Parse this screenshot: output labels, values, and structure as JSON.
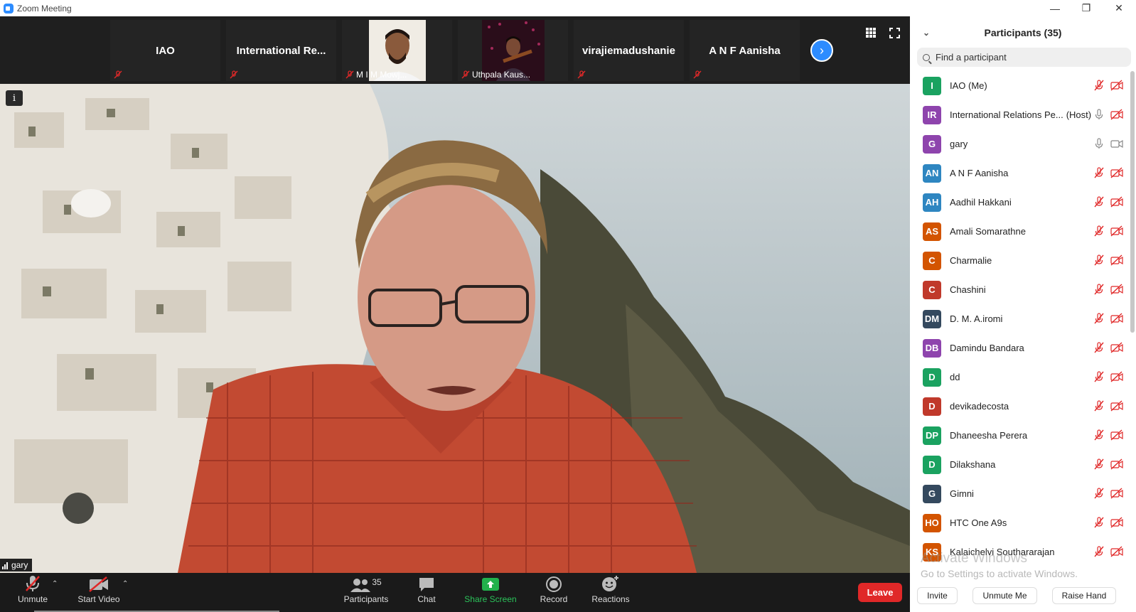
{
  "window": {
    "title": "Zoom Meeting"
  },
  "colors": {
    "accent": "#2d8cff",
    "leave": "#e02828",
    "mute": "#e02828",
    "share": "#22b14c"
  },
  "strip": {
    "thumbs": [
      {
        "name": "IAO",
        "caption": ""
      },
      {
        "name": "International  Re...",
        "caption": ""
      },
      {
        "name": "",
        "caption": "M I M Mowj..."
      },
      {
        "name": "",
        "caption": "Uthpala Kaus..."
      },
      {
        "name": "virajiemadushanie",
        "caption": ""
      },
      {
        "name": "A N F Aanisha",
        "caption": ""
      }
    ]
  },
  "stage": {
    "speaker_label": "gary"
  },
  "toolbar": {
    "unmute": "Unmute",
    "start_video": "Start Video",
    "participants": "Participants",
    "participants_count": "35",
    "chat": "Chat",
    "share_screen": "Share Screen",
    "record": "Record",
    "reactions": "Reactions",
    "leave": "Leave"
  },
  "panel": {
    "title": "Participants (35)",
    "search_placeholder": "Find a participant",
    "participants": [
      {
        "initials": "I",
        "name": "IAO (Me)",
        "host": "",
        "color": "#1aa260",
        "mic": "muted",
        "video": "off"
      },
      {
        "initials": "IR",
        "name": "International Relations Pe...",
        "host": "(Host)",
        "color": "#8e44ad",
        "mic": "on",
        "video": "off"
      },
      {
        "initials": "G",
        "name": "gary",
        "host": "",
        "color": "#8e44ad",
        "mic": "on",
        "video": "on"
      },
      {
        "initials": "AN",
        "name": "A N F Aanisha",
        "host": "",
        "color": "#2e86c1",
        "mic": "muted",
        "video": "off"
      },
      {
        "initials": "AH",
        "name": "Aadhil Hakkani",
        "host": "",
        "color": "#2e86c1",
        "mic": "muted",
        "video": "off"
      },
      {
        "initials": "AS",
        "name": "Amali Somarathne",
        "host": "",
        "color": "#d35400",
        "mic": "muted",
        "video": "off"
      },
      {
        "initials": "C",
        "name": "Charmalie",
        "host": "",
        "color": "#d35400",
        "mic": "muted",
        "video": "off"
      },
      {
        "initials": "C",
        "name": "Chashini",
        "host": "",
        "color": "#c0392b",
        "mic": "muted",
        "video": "off"
      },
      {
        "initials": "DM",
        "name": "D. M. A.iromi",
        "host": "",
        "color": "#34495e",
        "mic": "muted",
        "video": "off"
      },
      {
        "initials": "DB",
        "name": "Damindu Bandara",
        "host": "",
        "color": "#8e44ad",
        "mic": "muted",
        "video": "off"
      },
      {
        "initials": "D",
        "name": "dd",
        "host": "",
        "color": "#1aa260",
        "mic": "muted",
        "video": "off"
      },
      {
        "initials": "D",
        "name": "devikadecosta",
        "host": "",
        "color": "#c0392b",
        "mic": "muted",
        "video": "off"
      },
      {
        "initials": "DP",
        "name": "Dhaneesha Perera",
        "host": "",
        "color": "#1aa260",
        "mic": "muted",
        "video": "off"
      },
      {
        "initials": "D",
        "name": "Dilakshana",
        "host": "",
        "color": "#1aa260",
        "mic": "muted",
        "video": "off"
      },
      {
        "initials": "G",
        "name": "Gimni",
        "host": "",
        "color": "#34495e",
        "mic": "muted",
        "video": "off"
      },
      {
        "initials": "HO",
        "name": "HTC One A9s",
        "host": "",
        "color": "#d35400",
        "mic": "muted",
        "video": "off"
      },
      {
        "initials": "KS",
        "name": "Kalaichelvi Southararajan",
        "host": "",
        "color": "#d35400",
        "mic": "muted",
        "video": "off"
      }
    ],
    "footer": {
      "invite": "Invite",
      "unmute_me": "Unmute Me",
      "raise_hand": "Raise Hand"
    }
  },
  "watermark": {
    "line1": "Activate Windows",
    "line2": "Go to Settings to activate Windows."
  }
}
